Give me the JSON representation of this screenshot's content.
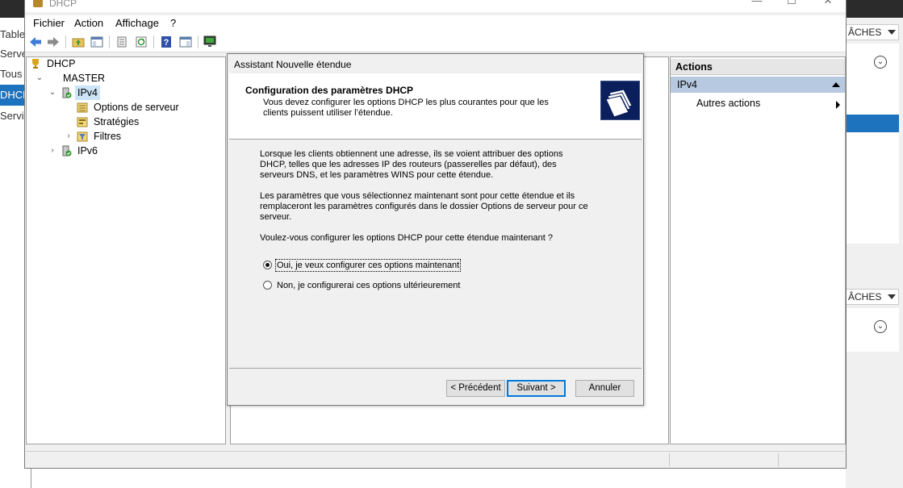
{
  "background": {
    "left_items": [
      "Table",
      "Serve",
      "Tous",
      "DHCF",
      "Servic"
    ],
    "right_tasks_label": "ÂCHES"
  },
  "window": {
    "title": "DHCP",
    "controls": {
      "minimize": "—",
      "maximize": "☐",
      "close": "✕"
    }
  },
  "menu": [
    "Fichier",
    "Action",
    "Affichage",
    "?"
  ],
  "toolbar": {
    "icons": [
      "back-arrow-icon",
      "forward-arrow-icon",
      "up-folder-icon",
      "show-hide-tree-icon",
      "properties-icon",
      "refresh-icon",
      "help-icon",
      "show-hide-action-pane-icon",
      "monitor-icon"
    ]
  },
  "tree": {
    "root": "DHCP",
    "server": "MASTER",
    "ipv4": "IPv4",
    "children": [
      "Options de serveur",
      "Stratégies",
      "Filtres"
    ],
    "ipv6": "IPv6"
  },
  "actions": {
    "header": "Actions",
    "section": "IPv4",
    "item": "Autres actions"
  },
  "wizard": {
    "title": "Assistant Nouvelle étendue",
    "heading": "Configuration des paramètres DHCP",
    "subheading": "Vous devez configurer les options DHCP les plus courantes pour que les clients puissent utiliser l’étendue.",
    "paragraph1": "Lorsque les clients obtiennent une adresse, ils se voient attribuer des options DHCP, telles que les adresses IP des routeurs (passerelles par défaut), des serveurs DNS, et les paramètres WINS pour cette étendue.",
    "paragraph2": "Les paramètres que vous sélectionnez maintenant sont pour cette étendue et ils remplaceront les paramètres configurés dans le dossier Options de serveur pour ce serveur.",
    "question": "Voulez-vous configurer les options DHCP pour cette étendue maintenant ?",
    "options": [
      {
        "label": "Oui, je veux configurer ces options maintenant",
        "checked": true
      },
      {
        "label": "Non, je configurerai ces options ultérieurement",
        "checked": false
      }
    ],
    "buttons": {
      "back": "< Précédent",
      "next": "Suivant >",
      "cancel": "Annuler"
    }
  }
}
